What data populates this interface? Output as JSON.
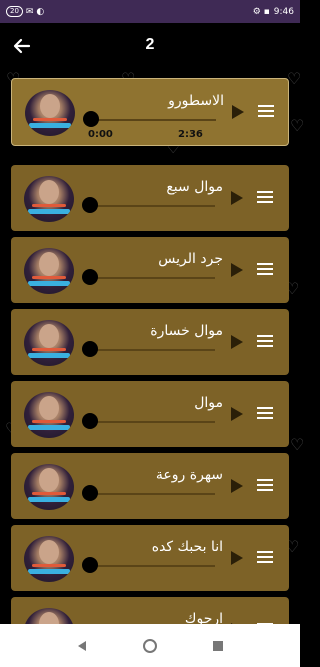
{
  "status_bar": {
    "left_badge": "20",
    "left_icons": "✉ ◐",
    "time": "9:46",
    "right_icons": "⚙ ▪"
  },
  "app_bar": {
    "title": "2",
    "back_icon": "arrow-left-icon"
  },
  "songs": [
    {
      "title": "الاسطورو",
      "current_time": "0:00",
      "total_time": "2:36",
      "active": true
    },
    {
      "title": "موال سبع",
      "current_time": "",
      "total_time": "",
      "active": false
    },
    {
      "title": "جرد الريس",
      "current_time": "",
      "total_time": "",
      "active": false
    },
    {
      "title": "موال خسارة",
      "current_time": "",
      "total_time": "",
      "active": false
    },
    {
      "title": "موال",
      "current_time": "",
      "total_time": "",
      "active": false
    },
    {
      "title": "سهرة روعة",
      "current_time": "",
      "total_time": "",
      "active": false
    },
    {
      "title": "انا بحبك كده",
      "current_time": "",
      "total_time": "",
      "active": false
    },
    {
      "title": "ارجوك",
      "current_time": "",
      "total_time": "",
      "active": false
    }
  ],
  "colors": {
    "card": "#7d6227",
    "card_active": "#8f7330",
    "status_bar": "#3f2a55",
    "background": "#000000"
  },
  "nav_bar": {
    "back_icon": "nav-back-icon",
    "home_icon": "nav-home-icon",
    "recents_icon": "nav-recents-icon"
  }
}
